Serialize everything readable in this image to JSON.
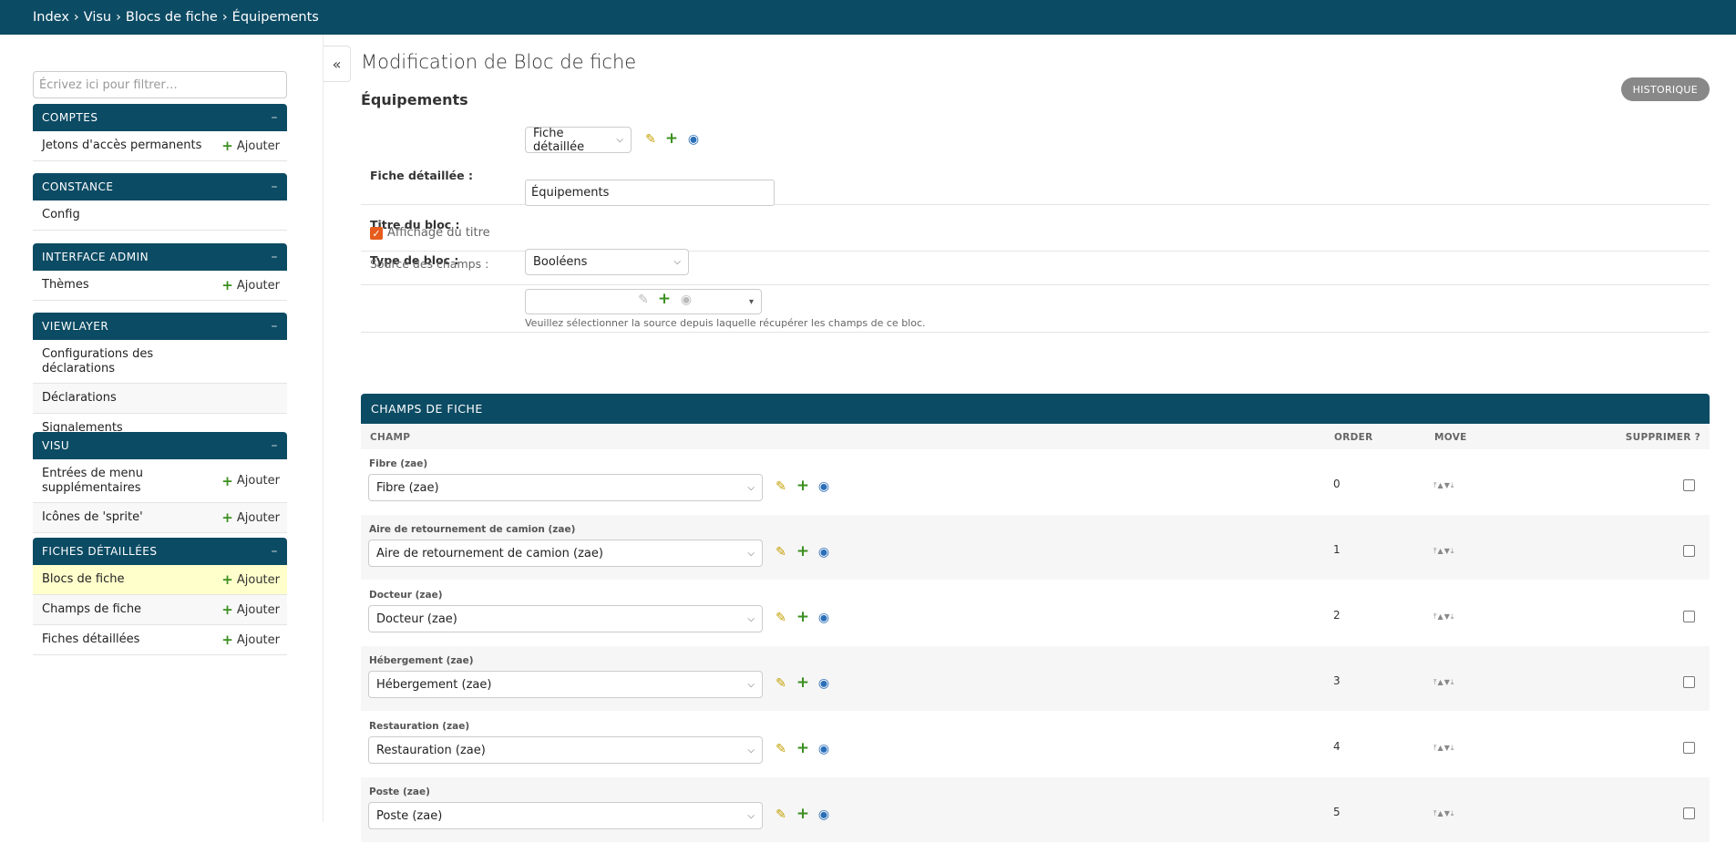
{
  "breadcrumb": [
    "Index",
    "Visu",
    "Blocs de fiche",
    "Équipements"
  ],
  "breadcrumb_separator": "›",
  "sidebar": {
    "filter_placeholder": "Écrivez ici pour filtrer…",
    "collapse_toggle": "–",
    "add_label": "Ajouter",
    "modules": [
      {
        "title": "COMPTES",
        "rows": [
          {
            "label": "Jetons d'accès permanents",
            "add": true
          }
        ]
      },
      {
        "title": "CONSTANCE",
        "rows": [
          {
            "label": "Config",
            "add": false
          }
        ]
      },
      {
        "title": "INTERFACE ADMIN",
        "rows": [
          {
            "label": "Thèmes",
            "add": true
          }
        ]
      },
      {
        "title": "VIEWLAYER",
        "rows": [
          {
            "label": "Configurations des déclarations",
            "add": false
          },
          {
            "label": "Déclarations",
            "add": false
          },
          {
            "label": "Signalements",
            "add": false
          }
        ]
      },
      {
        "title": "VISU",
        "rows": [
          {
            "label": "Entrées de menu supplémentaires",
            "add": true
          },
          {
            "label": "Icônes de 'sprite'",
            "add": true
          }
        ]
      },
      {
        "title": "FICHES DÉTAILLÉES",
        "rows": [
          {
            "label": "Blocs de fiche",
            "add": true,
            "current": true
          },
          {
            "label": "Champs de fiche",
            "add": true
          },
          {
            "label": "Fiches détaillées",
            "add": true
          }
        ]
      }
    ]
  },
  "collapse_button": "«",
  "page_title": "Modification de Bloc de fiche",
  "history_button": "HISTORIQUE",
  "object_title": "Équipements",
  "form": {
    "fiche_label": "Fiche détaillée :",
    "fiche_value": "Fiche détaillée",
    "titre_label": "Titre du bloc :",
    "titre_value": "Équipements",
    "affichage_label": "Affichage du titre",
    "affichage_checked": true,
    "type_label": "Type de bloc :",
    "type_value": "Booléens",
    "source_label": "Source des champs :",
    "source_value": "",
    "source_help": "Veuillez sélectionner la source depuis laquelle récupérer les champs de ce bloc."
  },
  "inline": {
    "title": "CHAMPS DE FICHE",
    "columns": {
      "champ": "CHAMP",
      "order": "ORDER",
      "move": "MOVE",
      "delete": "SUPPRIMER ?"
    },
    "rows": [
      {
        "label": "Fibre (zae)",
        "value": "Fibre (zae)",
        "order": "0"
      },
      {
        "label": "Aire de retournement de camion (zae)",
        "value": "Aire de retournement de camion (zae)",
        "order": "1"
      },
      {
        "label": "Docteur (zae)",
        "value": "Docteur (zae)",
        "order": "2"
      },
      {
        "label": "Hébergement (zae)",
        "value": "Hébergement (zae)",
        "order": "3"
      },
      {
        "label": "Restauration (zae)",
        "value": "Restauration (zae)",
        "order": "4"
      },
      {
        "label": "Poste (zae)",
        "value": "Poste (zae)",
        "order": "5"
      }
    ]
  },
  "icons": {
    "edit": "pencil-icon",
    "add": "plus-icon",
    "view": "eye-icon",
    "move": "move-arrows-icon"
  },
  "colors": {
    "header": "#0c4b64",
    "current_row": "#ffffcc",
    "add_green": "#3b8f1f",
    "checkbox_orange": "#e65c1c"
  }
}
